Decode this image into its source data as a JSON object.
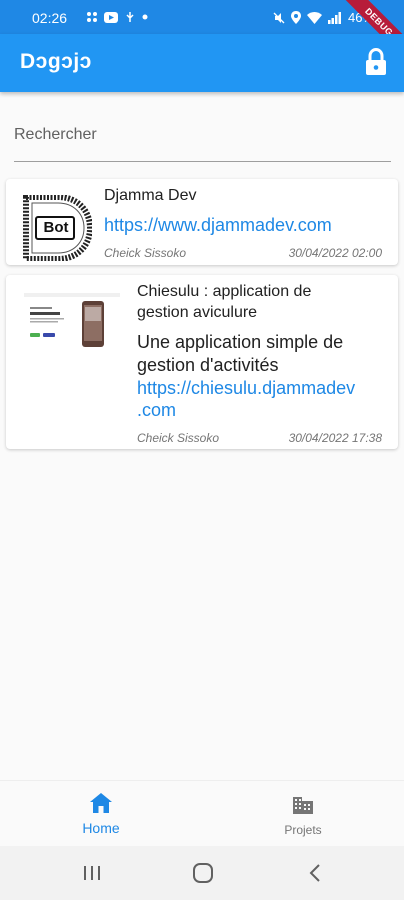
{
  "status_bar": {
    "time": "02:26",
    "battery": "46%",
    "debug_label": "DEBUG"
  },
  "app_bar": {
    "title": "Dɔgɔjɔ",
    "lock_icon": "lock-icon"
  },
  "search": {
    "placeholder": "Rechercher",
    "value": ""
  },
  "posts": [
    {
      "title": "Djamma Dev",
      "description": "",
      "link": "https://www.djammadev.com",
      "author": "Cheick Sissoko",
      "date": "30/04/2022 02:00",
      "thumbnail": "bot-logo"
    },
    {
      "title_line1": "Chiesulu : application de",
      "title_line2": "gestion aviculure",
      "desc_line1": "Une application simple de",
      "desc_line2": "gestion d'activités",
      "link_line1": "https://chiesulu.djammadev",
      "link_line2": ".com",
      "author": "Cheick Sissoko",
      "date": "30/04/2022 17:38",
      "thumbnail": "app-screenshot"
    }
  ],
  "bottom_nav": {
    "home_label": "Home",
    "projets_label": "Projets",
    "active": "Home"
  },
  "colors": {
    "primary": "#2196f3",
    "status_bar": "#1f88e5",
    "link": "#1e88e5"
  }
}
